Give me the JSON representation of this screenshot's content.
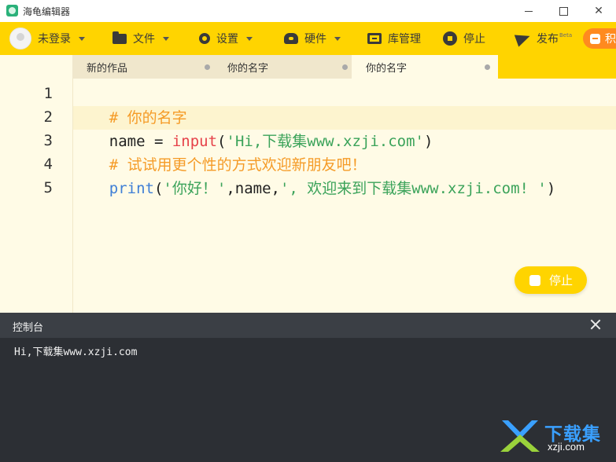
{
  "window": {
    "title": "海龟编辑器"
  },
  "toolbar": {
    "user_label": "未登录",
    "file_label": "文件",
    "settings_label": "设置",
    "hardware_label": "硬件",
    "library_label": "库管理",
    "stop_label": "停止",
    "publish_label": "发布",
    "publish_badge": "Beta",
    "mode_label": "积木"
  },
  "tabs": [
    {
      "label": "新的作品"
    },
    {
      "label": "你的名字"
    },
    {
      "label": "你的名字"
    }
  ],
  "editor": {
    "line_numbers": [
      "1",
      "2",
      "3",
      "4",
      "5"
    ],
    "lines": [
      [
        {
          "t": "# 你的名字"
        }
      ],
      [
        {
          "t": "name = "
        },
        {
          "t": "input"
        },
        {
          "t": "("
        },
        {
          "t": "'Hi,下载集www.xzji.com'"
        },
        {
          "t": ")"
        }
      ],
      [
        {
          "t": "# 试试用更个性的方式欢迎新朋友吧！"
        }
      ],
      [
        {
          "t": "print"
        },
        {
          "t": "("
        },
        {
          "t": "'你好！'"
        },
        {
          "t": ",name,"
        },
        {
          "t": "', 欢迎来到下载集www.xzji.com! '"
        },
        {
          "t": ")"
        }
      ],
      []
    ],
    "run_stop_label": "停止"
  },
  "console": {
    "title": "控制台",
    "output": "Hi,下载集www.xzji.com"
  },
  "watermark": {
    "cn_text": "下载集",
    "url_text": "xzji.com"
  },
  "colors": {
    "toolbar_yellow": "#ffd400",
    "editor_bg": "#fffbe6",
    "console_bg": "#2c2f34",
    "comment": "#f59b27",
    "builtin": "#e6424a",
    "string": "#3ba35a",
    "keyword_print": "#3f7fd6"
  }
}
